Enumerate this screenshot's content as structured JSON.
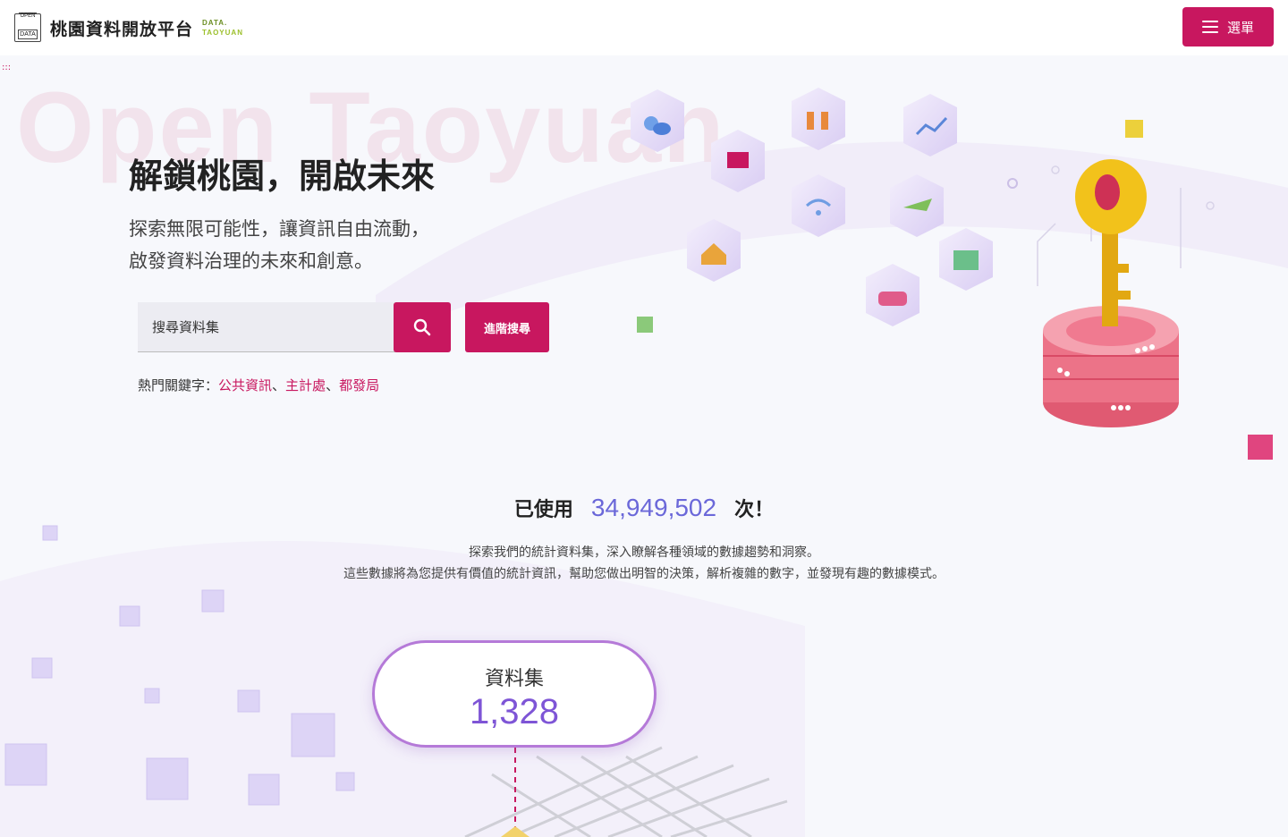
{
  "header": {
    "logo_top": "OPEN",
    "logo_bottom": "DATA",
    "site_title": "桃園資料開放平台",
    "site_sub_line1": "DATA.",
    "site_sub_line2": "TAOYUAN",
    "menu_label": "選單",
    "skip_link": ":::"
  },
  "hero": {
    "background_text": "Open Taoyuan",
    "title": "解鎖桃園，開啟未來",
    "desc_line1": "探索無限可能性，讓資訊自由流動，",
    "desc_line2": "啟發資料治理的未來和創意。",
    "search_placeholder": "搜尋資料集",
    "advanced_search_label": "進階搜尋",
    "keywords_label": "熱門關鍵字：",
    "keywords": [
      "公共資訊",
      "主計處",
      "都發局"
    ],
    "keyword_separator": "、"
  },
  "stats": {
    "usage_prefix": "已使用",
    "usage_count": "34,949,502",
    "usage_suffix": "次！",
    "intro_line1": "探索我們的統計資料集，深入瞭解各種領域的數據趨勢和洞察。",
    "intro_line2": "這些數據將為您提供有價值的統計資訊，幫助您做出明智的決策，解析複雜的數字，並發現有趣的數據模式。",
    "dataset_label": "資料集",
    "dataset_count": "1,328"
  },
  "colors": {
    "brand": "#c8175f",
    "accent_purple": "#7e55d6",
    "key_gold": "#f2c21b",
    "db_pink": "#e8617a"
  },
  "icons": [
    "weather-icon",
    "map-icon",
    "people-icon",
    "chart-icon",
    "wifi-icon",
    "plane-icon",
    "home-icon",
    "building-icon",
    "car-icon",
    "key-icon",
    "database-icon",
    "search-icon",
    "menu-icon"
  ]
}
